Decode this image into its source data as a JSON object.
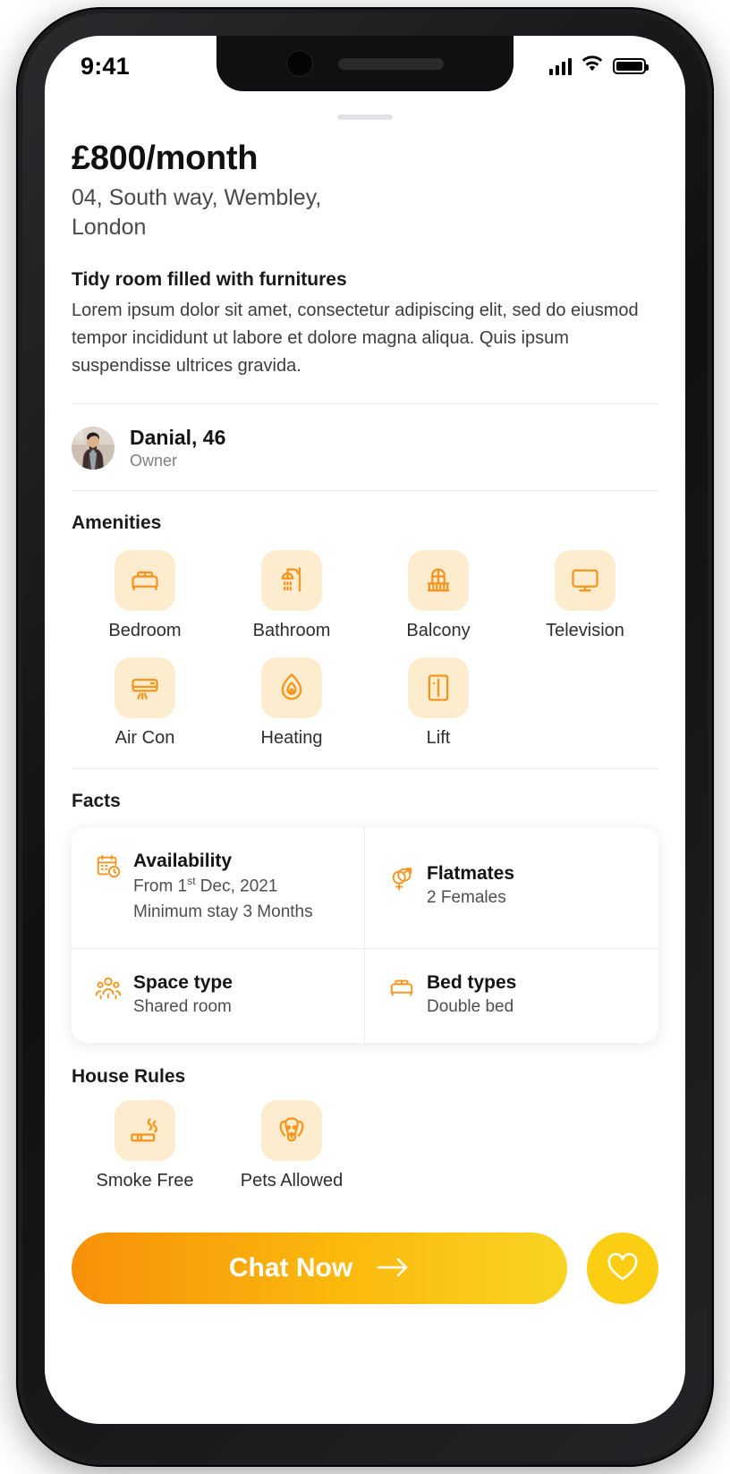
{
  "status_bar": {
    "time": "9:41",
    "signal_icon": "cellular-signal-icon",
    "wifi_icon": "wifi-icon",
    "battery_icon": "battery-full-icon"
  },
  "listing": {
    "price": "£800/month",
    "address": "04, South way, Wembley, London",
    "description_title": "Tidy room filled with furnitures",
    "description_body": "Lorem ipsum dolor sit amet, consectetur adipiscing elit, sed do eiusmod tempor incididunt ut labore et dolore magna aliqua. Quis ipsum suspendisse ultrices gravida."
  },
  "owner": {
    "name": "Danial, 46",
    "role": "Owner"
  },
  "amenities": {
    "title": "Amenities",
    "items": [
      {
        "label": "Bedroom",
        "icon": "bed-icon"
      },
      {
        "label": "Bathroom",
        "icon": "shower-icon"
      },
      {
        "label": "Balcony",
        "icon": "balcony-icon"
      },
      {
        "label": "Television",
        "icon": "television-icon"
      },
      {
        "label": "Air Con",
        "icon": "air-conditioner-icon"
      },
      {
        "label": "Heating",
        "icon": "flame-drop-icon"
      },
      {
        "label": "Lift",
        "icon": "elevator-icon"
      }
    ]
  },
  "facts": {
    "title": "Facts",
    "items": [
      {
        "title": "Availability",
        "icon": "calendar-clock-icon",
        "line1": "From 1",
        "sup": "st",
        "line1_rest": " Dec, 2021",
        "line2": "Minimum stay 3 Months"
      },
      {
        "title": "Flatmates",
        "icon": "gender-symbols-icon",
        "line1": "2 Females"
      },
      {
        "title": "Space type",
        "icon": "people-group-icon",
        "line1": "Shared room"
      },
      {
        "title": "Bed types",
        "icon": "bed-icon",
        "line1": "Double bed"
      }
    ]
  },
  "house_rules": {
    "title": "House Rules",
    "items": [
      {
        "label": "Smoke Free",
        "icon": "cigarette-icon"
      },
      {
        "label": "Pets Allowed",
        "icon": "dog-icon"
      }
    ]
  },
  "actions": {
    "chat_label": "Chat Now",
    "chat_arrow_icon": "arrow-right-icon",
    "favorite_icon": "heart-icon"
  },
  "colors": {
    "accent_orange": "#f7941d",
    "tile_bg": "#fdeccd",
    "button_gradient_start": "#f79009",
    "button_gradient_end": "#f9d423",
    "favorite_bg": "#fbcd13"
  }
}
